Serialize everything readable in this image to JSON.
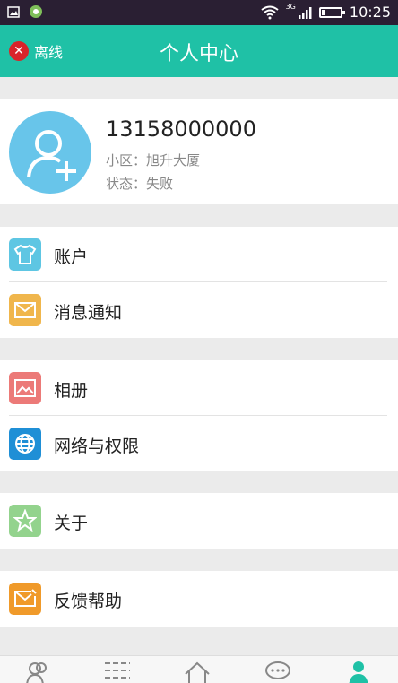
{
  "status_bar": {
    "network": "3G",
    "time": "10:25",
    "battery_level": 0.2
  },
  "header": {
    "title": "个人中心",
    "offline_label": "离线"
  },
  "profile": {
    "phone": "13158000000",
    "community_label": "小区：",
    "community_value": "旭升大厦",
    "status_label": "状态：",
    "status_value": "失败"
  },
  "menu": {
    "account": "账户",
    "notifications": "消息通知",
    "album": "相册",
    "network_permissions": "网络与权限",
    "about": "关于",
    "feedback_help": "反馈帮助"
  },
  "colors": {
    "primary": "#1fc1a6",
    "account_icon": "#5ec6e3",
    "notifications_icon": "#f0b64c",
    "album_icon": "#ec7a78",
    "network_icon": "#1f8fd6",
    "about_icon": "#93d38d",
    "feedback_icon": "#f09a2a"
  },
  "tabs": [
    {
      "icon": "contacts-icon",
      "active": false
    },
    {
      "icon": "list-icon",
      "active": false
    },
    {
      "icon": "home-icon",
      "active": false
    },
    {
      "icon": "chat-icon",
      "active": false
    },
    {
      "icon": "profile-icon",
      "active": true
    }
  ]
}
